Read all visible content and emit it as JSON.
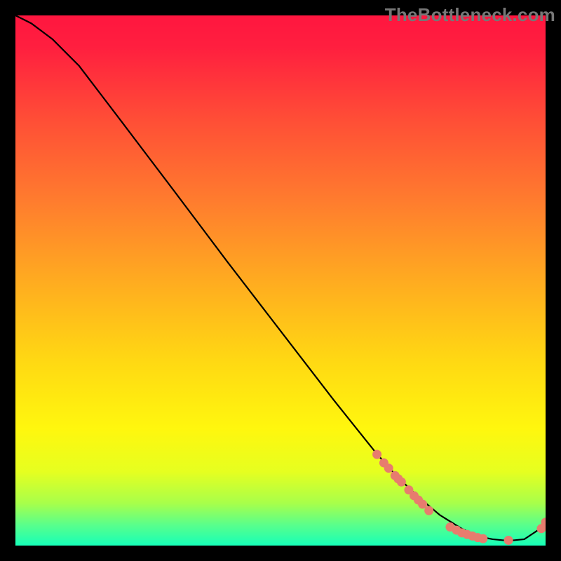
{
  "watermark": "TheBottleneck.com",
  "colors": {
    "black": "#000000",
    "line": "#000000",
    "dot_fill": "#e77c6e",
    "dot_stroke": "#9b4a3f",
    "watermark": "#777777"
  },
  "chart_data": {
    "type": "line",
    "title": "",
    "xlabel": "",
    "ylabel": "",
    "xlim": [
      0,
      1
    ],
    "ylim": [
      0,
      1
    ],
    "series": [
      {
        "name": "curve",
        "x": [
          0.0,
          0.03,
          0.07,
          0.12,
          0.2,
          0.3,
          0.4,
          0.5,
          0.6,
          0.68,
          0.72,
          0.76,
          0.8,
          0.84,
          0.86,
          0.88,
          0.9,
          0.92,
          0.94,
          0.96,
          0.99,
          1.0
        ],
        "y": [
          1.0,
          0.985,
          0.955,
          0.905,
          0.8,
          0.668,
          0.535,
          0.405,
          0.275,
          0.175,
          0.13,
          0.092,
          0.058,
          0.033,
          0.023,
          0.016,
          0.012,
          0.01,
          0.01,
          0.012,
          0.032,
          0.042
        ]
      },
      {
        "name": "dots",
        "x": [
          0.682,
          0.695,
          0.704,
          0.716,
          0.722,
          0.728,
          0.742,
          0.752,
          0.76,
          0.768,
          0.78,
          0.82,
          0.832,
          0.842,
          0.852,
          0.862,
          0.872,
          0.882,
          0.93,
          0.992,
          1.0
        ],
        "y": [
          0.172,
          0.156,
          0.146,
          0.132,
          0.126,
          0.12,
          0.105,
          0.094,
          0.086,
          0.078,
          0.066,
          0.035,
          0.029,
          0.024,
          0.021,
          0.018,
          0.015,
          0.013,
          0.01,
          0.032,
          0.044
        ]
      }
    ],
    "gradient_stops": [
      {
        "offset": 0.0,
        "color": "#ff163f"
      },
      {
        "offset": 0.06,
        "color": "#ff1f3f"
      },
      {
        "offset": 0.2,
        "color": "#ff4f36"
      },
      {
        "offset": 0.35,
        "color": "#ff7c2e"
      },
      {
        "offset": 0.5,
        "color": "#ffab20"
      },
      {
        "offset": 0.65,
        "color": "#ffd813"
      },
      {
        "offset": 0.78,
        "color": "#fff70e"
      },
      {
        "offset": 0.86,
        "color": "#e6ff20"
      },
      {
        "offset": 0.92,
        "color": "#a8ff4a"
      },
      {
        "offset": 0.96,
        "color": "#5bff8a"
      },
      {
        "offset": 1.0,
        "color": "#16ffb8"
      }
    ]
  }
}
